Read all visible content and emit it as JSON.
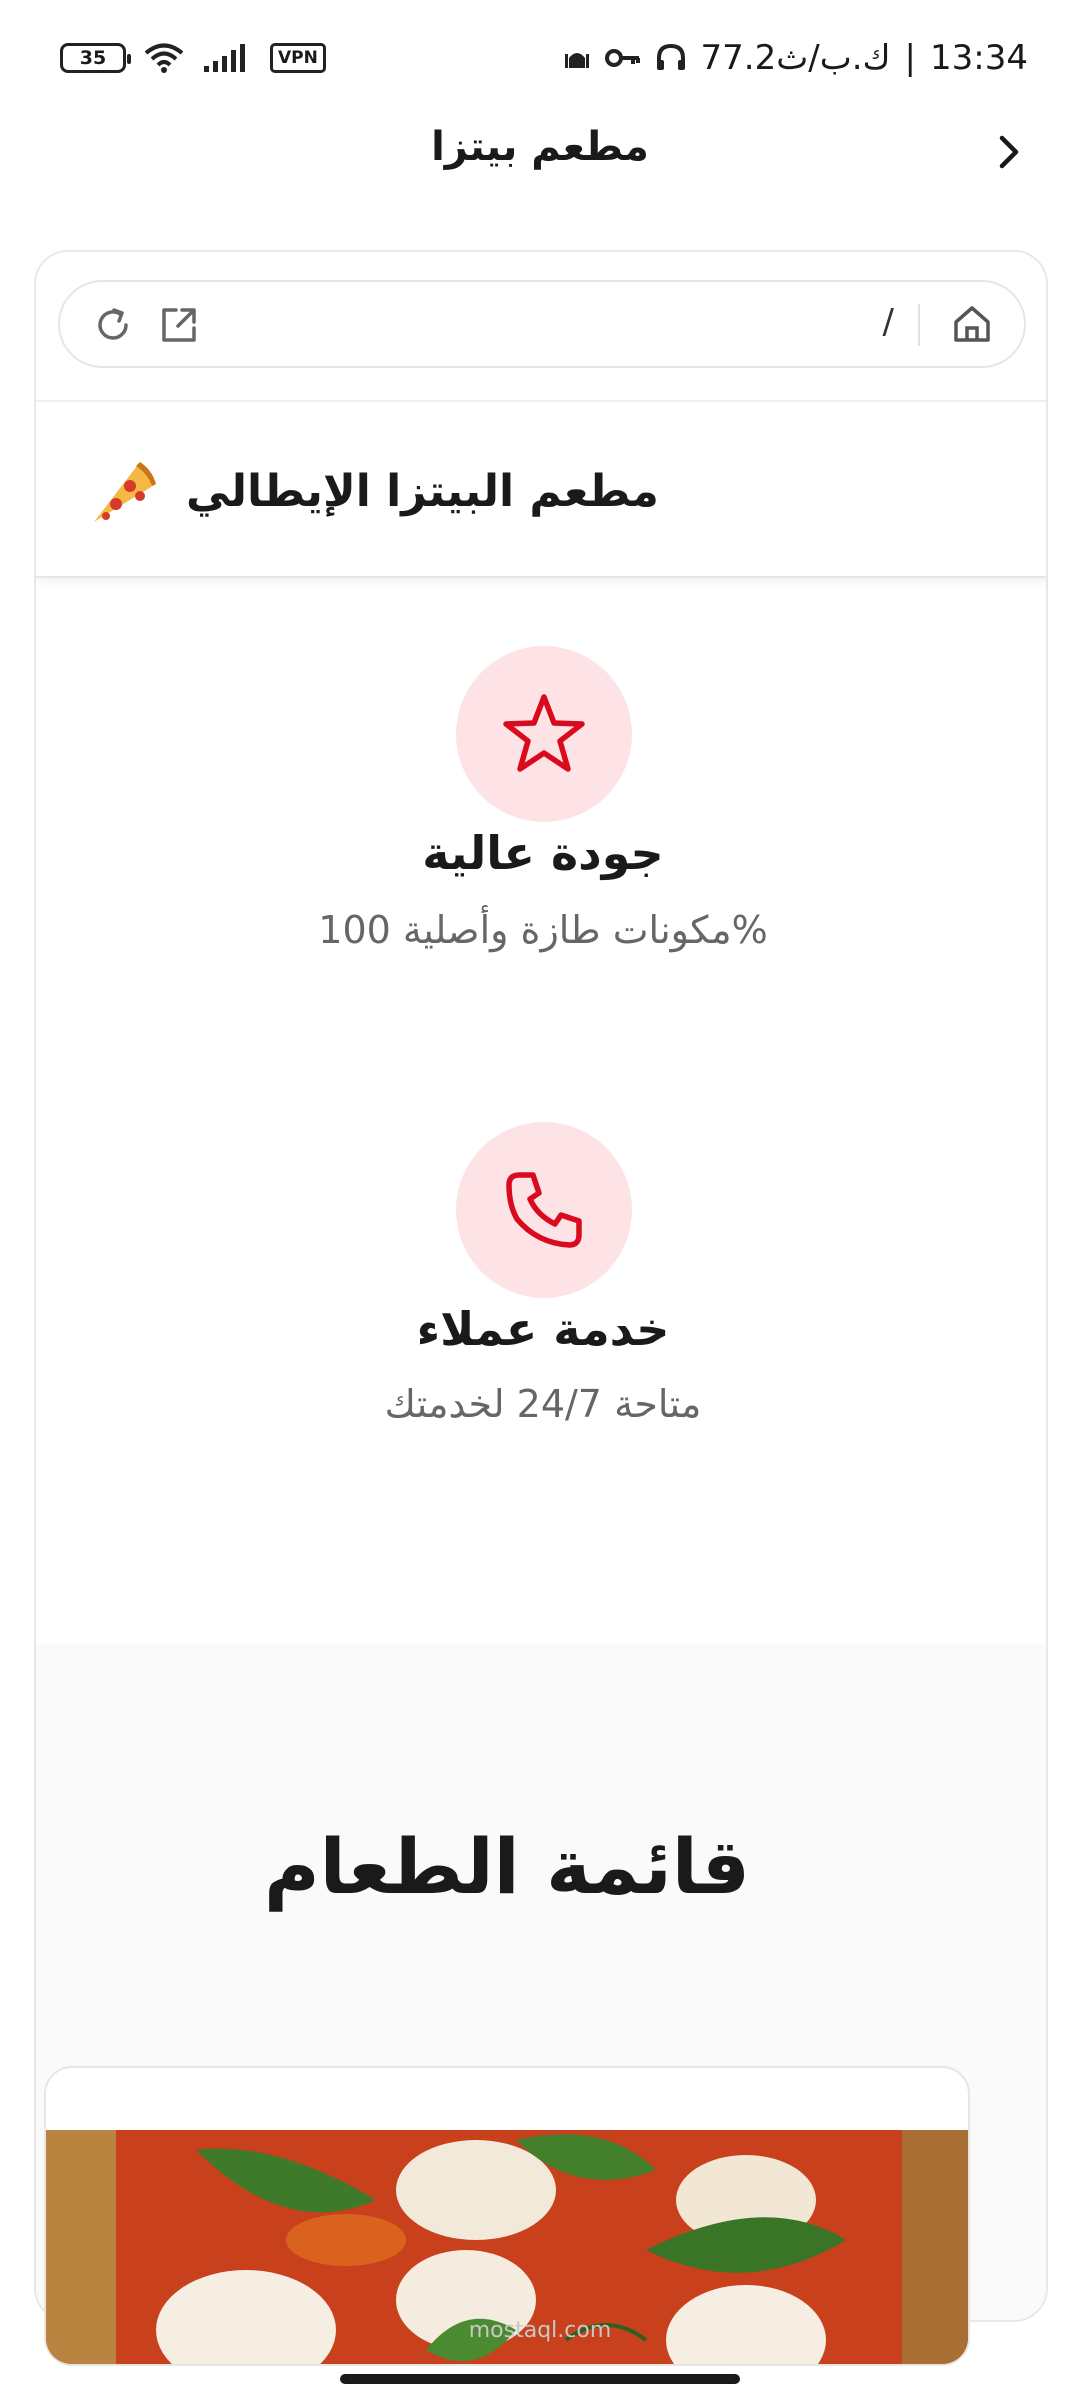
{
  "status_bar": {
    "battery": "35",
    "vpn": "VPN",
    "network_speed": "77.2ك.ب/ث",
    "separator": "|",
    "time": "13:34"
  },
  "app_header": {
    "title": "مطعم بيتزا"
  },
  "browser": {
    "url_path": "/"
  },
  "site": {
    "title": "مطعم البيتزا الإيطالي",
    "features": [
      {
        "title": "جودة عالية",
        "description": "%مكونات طازة وأصلية 100",
        "icon": "star-icon"
      },
      {
        "title": "خدمة عملاء",
        "description": "متاحة 24/7 لخدمتك",
        "icon": "phone-icon"
      }
    ],
    "menu": {
      "title": "قائمة الطعام",
      "items": [
        {
          "image": "margherita-pizza-photo"
        }
      ]
    }
  },
  "watermark": "mostaql.com",
  "colors": {
    "accent": "#d90a1e",
    "icon_circle_bg": "#fde3e5",
    "muted_text": "#666666"
  }
}
